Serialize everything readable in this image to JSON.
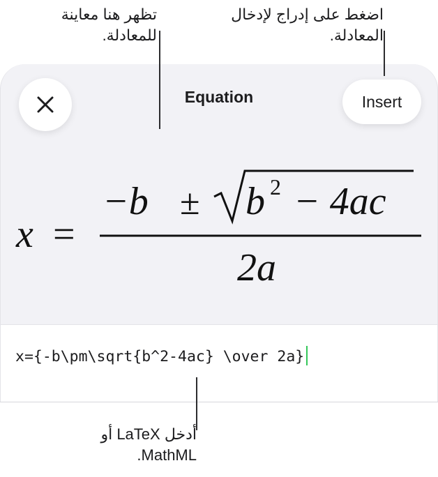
{
  "callouts": {
    "preview": [
      "تظهر هنا معاينة",
      "للمعادلة."
    ],
    "insert": [
      "اضغط على إدراج لإدخال",
      "المعادلة."
    ],
    "latex": [
      "أدخل LaTeX أو",
      "MathML."
    ]
  },
  "sheet": {
    "title": "Equation",
    "insert_label": "Insert",
    "close_icon": "close-icon"
  },
  "preview": {
    "lhs": "x",
    "equals": "=",
    "numerator": {
      "minus_b": "−b",
      "plus_minus": "±",
      "radicand_b": "b",
      "exponent": "2",
      "radicand_rest": "− 4ac"
    },
    "denominator": "2a"
  },
  "input": {
    "value": "x={-b\\pm\\sqrt{b^2-4ac} \\over 2a}"
  },
  "colors": {
    "sheet_background": "#f2f2f6",
    "caret": "#34c759",
    "button_background": "#ffffff"
  }
}
